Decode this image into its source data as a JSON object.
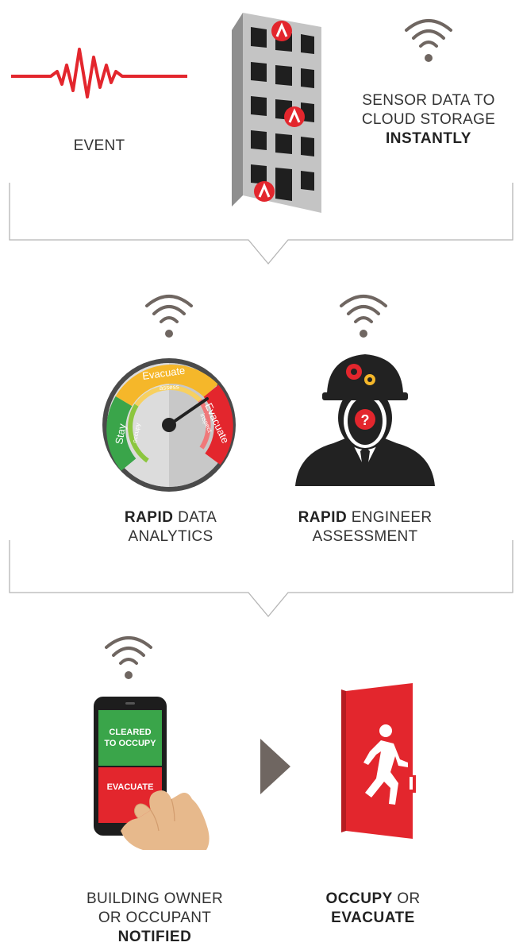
{
  "section1": {
    "event_label": "EVENT",
    "sensor_line1": "SENSOR DATA TO",
    "sensor_line2": "CLOUD STORAGE",
    "sensor_line3": "INSTANTLY"
  },
  "section2": {
    "gauge": {
      "zone_stay": "Stay",
      "zone_stay_sub": "occupy",
      "zone_evacuate_assess": "Evacuate",
      "zone_evacuate_assess_sub": "assess",
      "zone_evacuate_inspect": "Evacuate",
      "zone_evacuate_inspect_sub": "inspect"
    },
    "analytics_bold": "RAPID",
    "analytics_rest1": " DATA",
    "analytics_line2": "ANALYTICS",
    "engineer_bold": "RAPID",
    "engineer_rest1": " ENGINEER",
    "engineer_line2": "ASSESSMENT",
    "engineer_question": "?"
  },
  "section3": {
    "phone_cleared_line1": "CLEARED",
    "phone_cleared_line2": "TO OCCUPY",
    "phone_evacuate": "EVACUATE",
    "owner_line1": "BUILDING OWNER",
    "owner_line2": "OR OCCUPANT",
    "owner_line3": "NOTIFIED",
    "action_bold1": "OCCUPY",
    "action_rest1": " OR",
    "action_bold2": "EVACUATE"
  },
  "colors": {
    "red": "#e3262d",
    "gray_text": "#333333",
    "wifi": "#6f6661",
    "connector": "#b5b5b5",
    "green": "#3aa54a",
    "yellow": "#f5b72a"
  },
  "icons": [
    "seismic-wave-icon",
    "building-sensor-icon",
    "wifi-icon",
    "gauge-icon",
    "engineer-icon",
    "phone-icon",
    "arrow-right-icon",
    "exit-door-icon"
  ]
}
